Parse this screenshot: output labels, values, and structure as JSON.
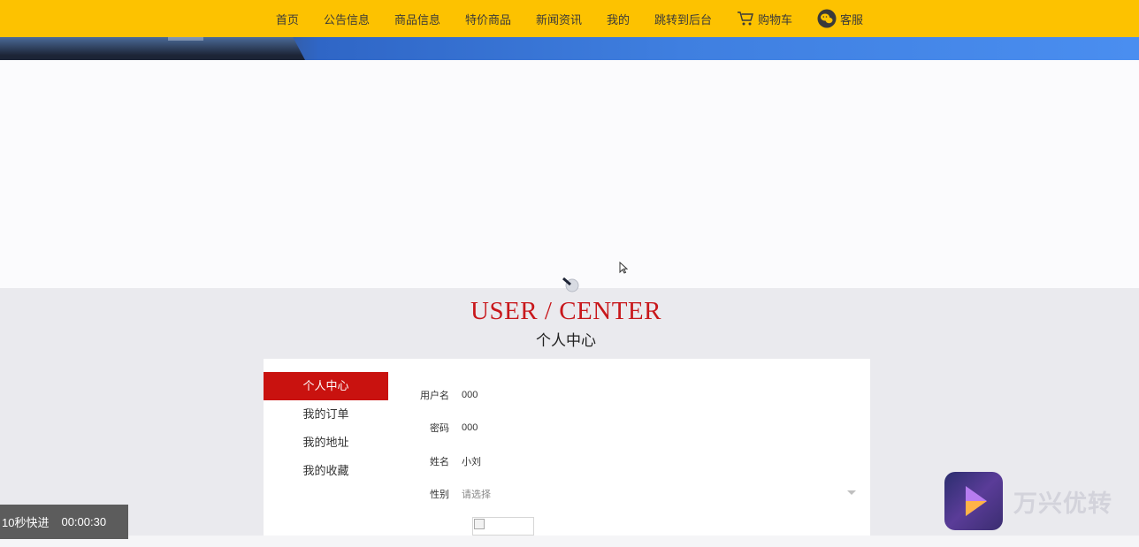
{
  "nav": {
    "items": [
      {
        "label": "首页"
      },
      {
        "label": "公告信息"
      },
      {
        "label": "商品信息"
      },
      {
        "label": "特价商品"
      },
      {
        "label": "新闻资讯"
      },
      {
        "label": "我的"
      },
      {
        "label": "跳转到后台"
      },
      {
        "label": "购物车",
        "icon": "cart-icon"
      },
      {
        "label": "客服",
        "icon": "wechat-icon"
      }
    ]
  },
  "title": {
    "en": "USER / CENTER",
    "cn": "个人中心"
  },
  "sidebar": {
    "items": [
      {
        "label": "个人中心",
        "active": true
      },
      {
        "label": "我的订单"
      },
      {
        "label": "我的地址"
      },
      {
        "label": "我的收藏"
      }
    ]
  },
  "form": {
    "username": {
      "label": "用户名",
      "value": "000"
    },
    "password": {
      "label": "密码",
      "value": "000"
    },
    "name": {
      "label": "姓名",
      "value": "小刘"
    },
    "gender": {
      "label": "性别",
      "placeholder": "请选择"
    }
  },
  "recorder": {
    "label": "10秒快进",
    "time": "00:00:30"
  },
  "watermark": {
    "text": "万兴优转"
  },
  "colors": {
    "nav_bg": "#fdc200",
    "accent_red": "#c9120f"
  }
}
